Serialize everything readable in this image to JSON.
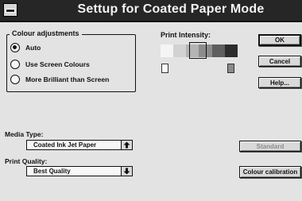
{
  "window": {
    "title": "Settup for Coated Paper Mode"
  },
  "colour_adjustments": {
    "label": "Colour adjustments",
    "options": [
      {
        "label": "Auto",
        "checked": true
      },
      {
        "label": "Use Screen Colours",
        "checked": false
      },
      {
        "label": "More Brilliant than Screen",
        "checked": false
      }
    ]
  },
  "print_intensity": {
    "label": "Print Intensity:",
    "swatch_colors": [
      "#f4f4f4",
      "#d2d2d2",
      "#b4b4b4",
      "#8c8c8c",
      "#5e5e5e",
      "#2c2c2c"
    ],
    "selected_level": 3,
    "levels": 6
  },
  "buttons": {
    "ok": "OK",
    "cancel": "Cancel",
    "help": "Help...",
    "standard": "Standard",
    "colour_calibration": "Colour calibration"
  },
  "media_type": {
    "label": "Media Type:",
    "value": "Coated Ink Jet Paper"
  },
  "print_quality": {
    "label": "Print Quality:",
    "value": "Best Quality"
  },
  "icons": {
    "system_menu": "system-menu-icon",
    "light_page": "light-page-icon",
    "dark_page": "dark-page-icon",
    "media_arrow": "arrow-up-icon",
    "quality_arrow": "arrow-down-icon"
  }
}
